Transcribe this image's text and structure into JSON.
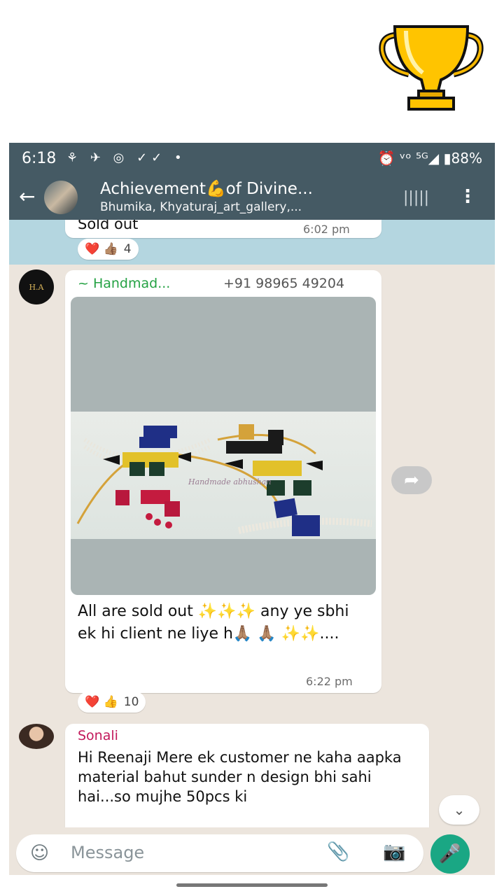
{
  "status": {
    "time": "6:18",
    "left_icons": "⚘ ✈ ◎ ✓✓ •",
    "right_text": "⏰ ᵛᵒ ⁵ᴳ◢ ▮88%"
  },
  "header": {
    "title": "Achievement💪of Divine...",
    "subtitle": "Bhumika, Khyaturaj_art_gallery,..."
  },
  "messages": {
    "m1": {
      "text": "Sold out",
      "time": "6:02 pm",
      "reactions": "❤️ 👍🏽",
      "reaction_count": "4"
    },
    "m2": {
      "sender": "~ Handmad...",
      "phone": "+91 98965 49204",
      "avatar_text": "H.A",
      "image_watermark": "Handmade abhushan",
      "caption": "All are sold out ✨✨✨ any ye sbhi ek hi client ne liye h🙏🏽 🙏🏽 ✨✨....",
      "time": "6:22 pm",
      "reactions": "❤️ 👍",
      "reaction_count": "10"
    },
    "m3": {
      "sender": "Sonali",
      "text": "Hi Reenaji Mere ek customer ne kaha aapka material bahut sunder n design bhi sahi hai...so mujhe 50pcs ki"
    }
  },
  "input": {
    "placeholder": "Message"
  },
  "icons": {
    "trophy": "trophy-icon",
    "back": "back-arrow-icon",
    "forward": "forward-icon",
    "mic": "mic-icon",
    "camera": "camera-icon",
    "attach": "paperclip-icon",
    "emoji": "emoji-icon"
  },
  "colors": {
    "appbar": "#455a64",
    "accent": "#1aa784",
    "chat_bg": "#ece5dd"
  }
}
